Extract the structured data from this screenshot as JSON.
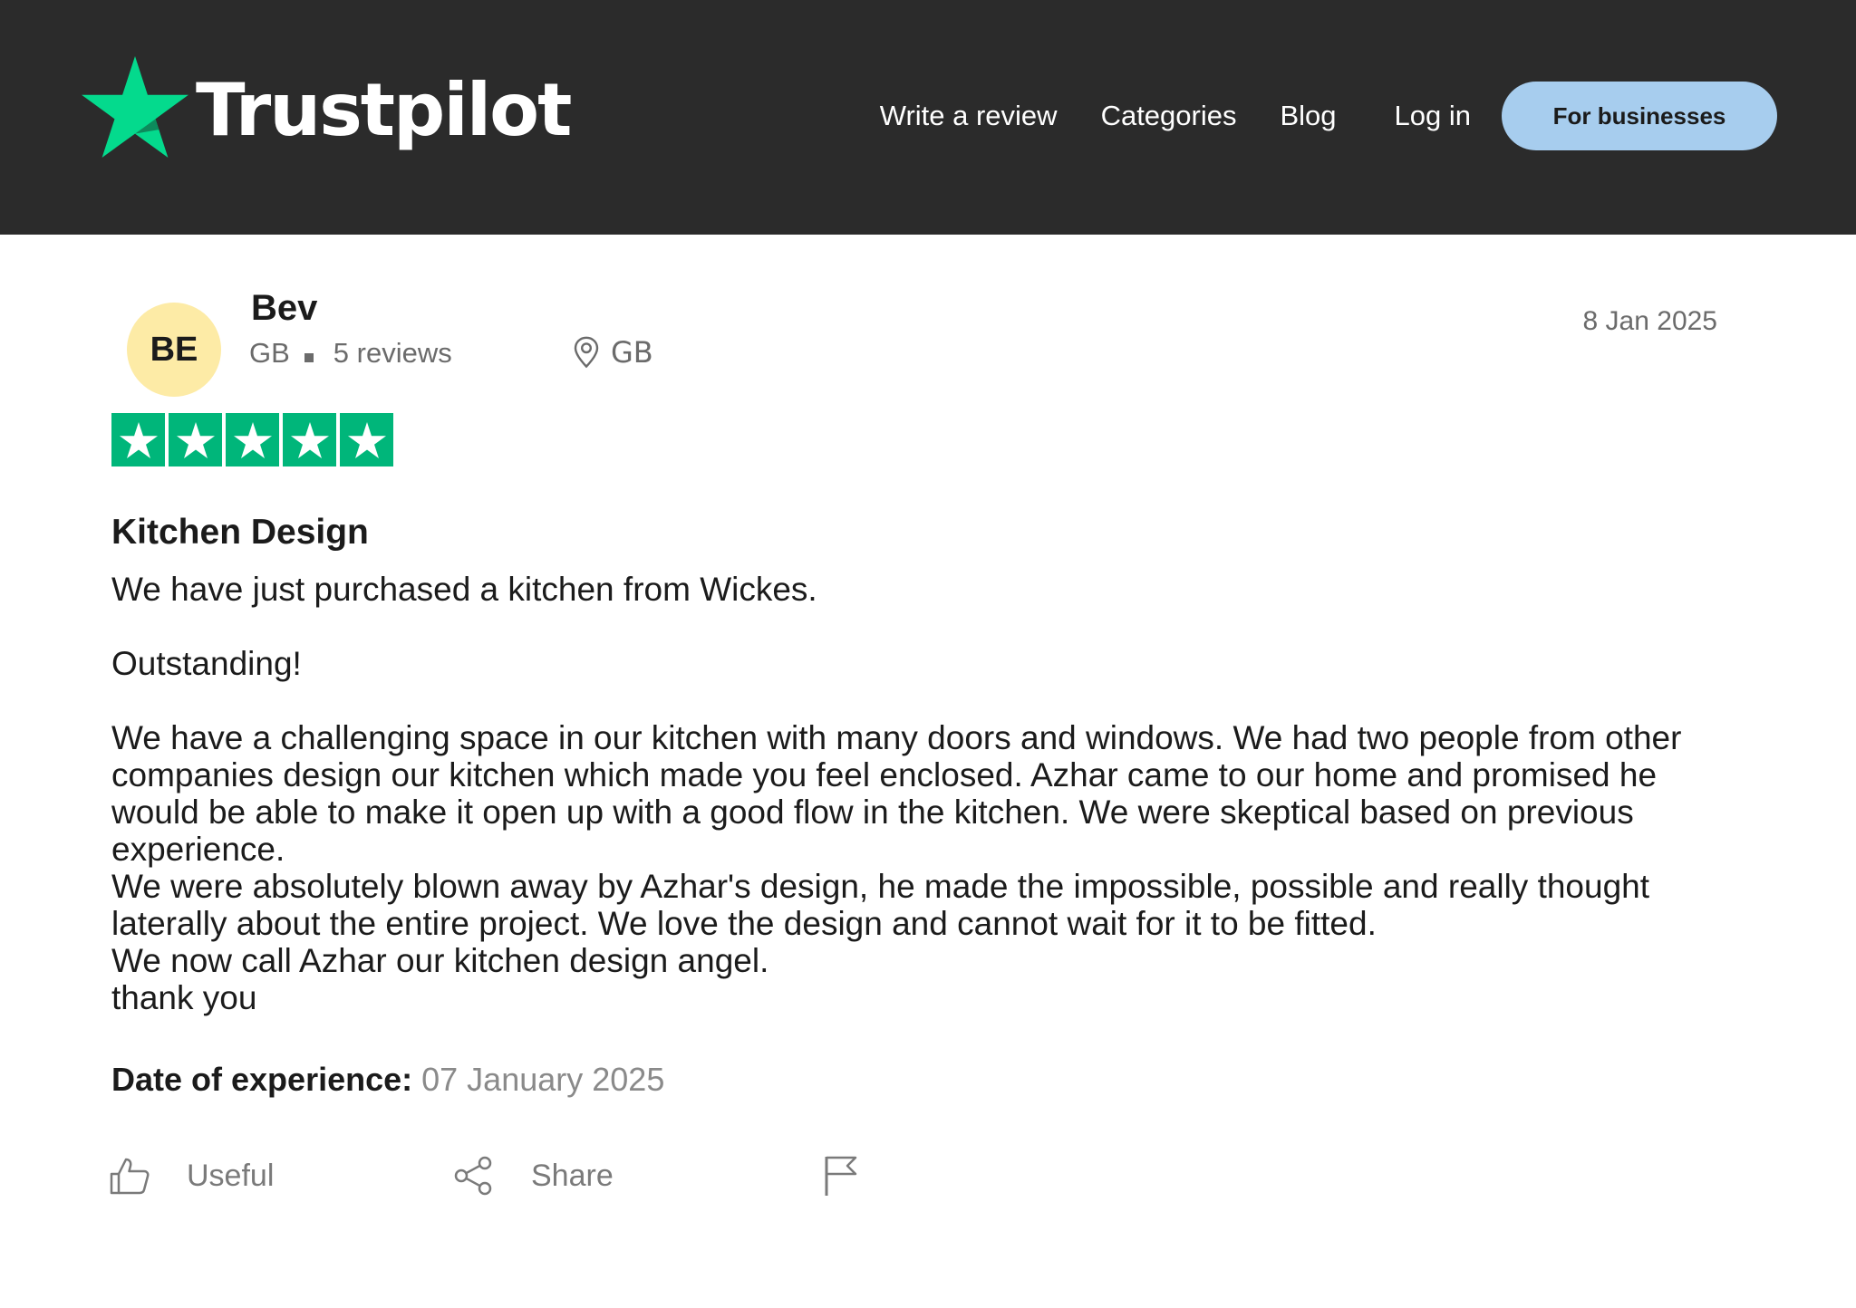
{
  "header": {
    "logo_text": "Trustpilot",
    "nav": [
      "Write a review",
      "Categories",
      "Blog",
      "Log in"
    ],
    "cta_label": "For businesses"
  },
  "review": {
    "avatar_initials": "BE",
    "reviewer_name": "Bev",
    "reviewer_country": "GB",
    "review_count": "5 reviews",
    "location": "GB",
    "date": "8 Jan 2025",
    "rating_stars": 5,
    "rating_max": 5,
    "title": "Kitchen Design",
    "body": {
      "p1": "We have just purchased a kitchen from Wickes.",
      "p2": "Outstanding!",
      "p3": "We have a challenging space in our kitchen with many doors and windows. We had two people from other companies design our kitchen which made you feel enclosed. Azhar came to our home and promised he would be able to make it open up with a good flow in the kitchen. We were skeptical based on previous experience.",
      "p4": "We were absolutely blown away by Azhar's design, he made the impossible, possible and really thought laterally about the entire project. We love the design and cannot wait for it to be fitted.",
      "p5": "We now call Azhar our kitchen design angel.",
      "p6": "thank you"
    },
    "experience_label": "Date of experience:",
    "experience_date": "07 January 2025"
  },
  "actions": {
    "useful_label": "Useful",
    "share_label": "Share"
  },
  "icons": {
    "logo": "trustpilot-star-icon",
    "location": "map-pin-icon",
    "rating": "star-icon",
    "useful": "thumbs-up-icon",
    "share": "share-icon",
    "report": "flag-icon"
  },
  "colors": {
    "header_bg": "#2b2b2b",
    "brand_green": "#00b67a",
    "cta_bg": "#a7cdee",
    "avatar_bg": "#fdeba6"
  }
}
